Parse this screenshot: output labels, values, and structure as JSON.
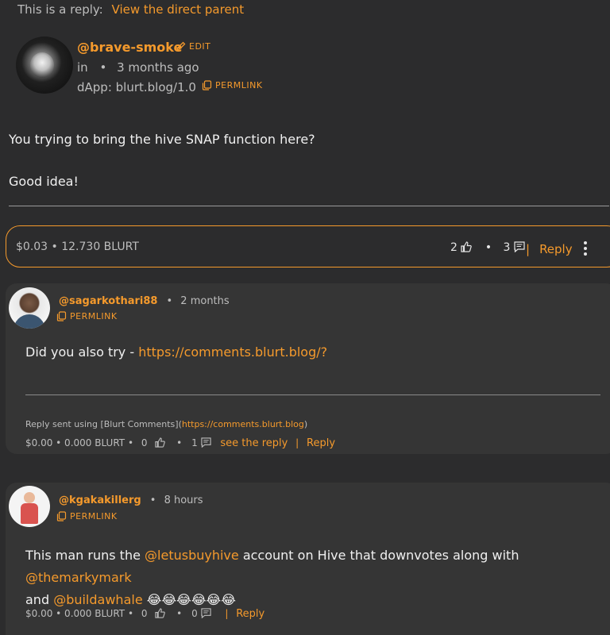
{
  "reply_notice": {
    "label": "This is a reply:",
    "link": "View the direct parent"
  },
  "main_post": {
    "author": "@brave-smoke",
    "edit_label": "EDIT",
    "in_label": "in",
    "time": "3 months ago",
    "dapp": "dApp: blurt.blog/1.0",
    "permlink_label": "PERMLINK",
    "body": [
      "You trying to bring the hive SNAP function here?",
      "Good idea!"
    ],
    "payout": "$0.03 • 12.730 BLURT",
    "upvotes": "2",
    "comments": "3",
    "reply_label": "Reply"
  },
  "comments": [
    {
      "author": "@sagarkothari88",
      "time": "2 months",
      "permlink_label": "PERMLINK",
      "body_prefix": "Did you also try - ",
      "body_link": "https://comments.blurt.blog/?",
      "sent_prefix": "Reply sent using [Blurt Comments](",
      "sent_link": "https://comments.blurt.blog",
      "sent_suffix": ")",
      "payout": "$0.00 • 0.000 BLURT •",
      "upvotes": "0",
      "replies": "1",
      "see_reply": "see the reply",
      "reply_label": "Reply"
    },
    {
      "author": "@kgakakillerg",
      "time": "8 hours",
      "permlink_label": "PERMLINK",
      "body_1": "This man runs the ",
      "link_1": "@letusbuyhive",
      "body_2": " account on Hive that downvotes along with ",
      "link_2": "@themarkymark",
      "body_3": "and ",
      "link_3": "@buildawhale",
      "emojis": " 😂😂😂😂😂😂",
      "payout": "$0.00 • 0.000 BLURT •",
      "upvotes": "0",
      "replies": "0",
      "reply_label": "Reply"
    }
  ],
  "colors": {
    "accent": "#f59a2c",
    "background": "#2c2c2d",
    "card": "#353535"
  }
}
